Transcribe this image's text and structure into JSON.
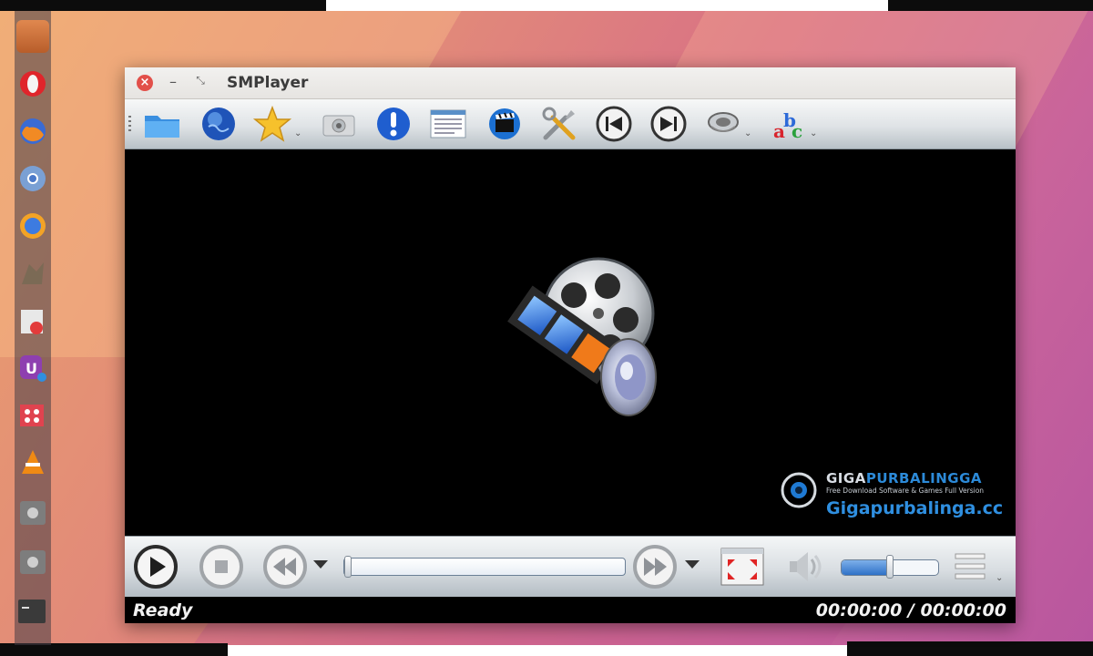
{
  "window": {
    "title": "SMPlayer",
    "close_glyph": "×",
    "minimize_glyph": "–",
    "restore_glyph": "⤡"
  },
  "launcher": {
    "items": [
      "files-icon",
      "opera-icon",
      "firefox-icon",
      "chromium-icon",
      "firefox-alt-icon",
      "gimp-icon",
      "text-editor-icon",
      "ubuntu-software-icon",
      "app-grid-icon",
      "vlc-icon",
      "drive-icon",
      "drive-icon",
      "terminal-icon"
    ]
  },
  "toolbar": {
    "buttons": [
      "open-folder",
      "open-url",
      "favorites",
      "screenshot",
      "info",
      "playlist",
      "video-equalizer",
      "preferences",
      "previous",
      "next",
      "audio-track",
      "subtitles"
    ]
  },
  "watermark": {
    "brand_left": "GIGA",
    "brand_right": "PURBALINGGA",
    "tagline": "Free Download Software & Games Full Version",
    "url": "Gigapurbalinga.cc"
  },
  "controls": {
    "seek_progress": 0.0,
    "volume_level": 0.5
  },
  "status": {
    "left": "Ready",
    "time": "00:00:00 / 00:00:00"
  },
  "colors": {
    "accent_blue": "#2f71c7",
    "status_bg": "#000000"
  }
}
